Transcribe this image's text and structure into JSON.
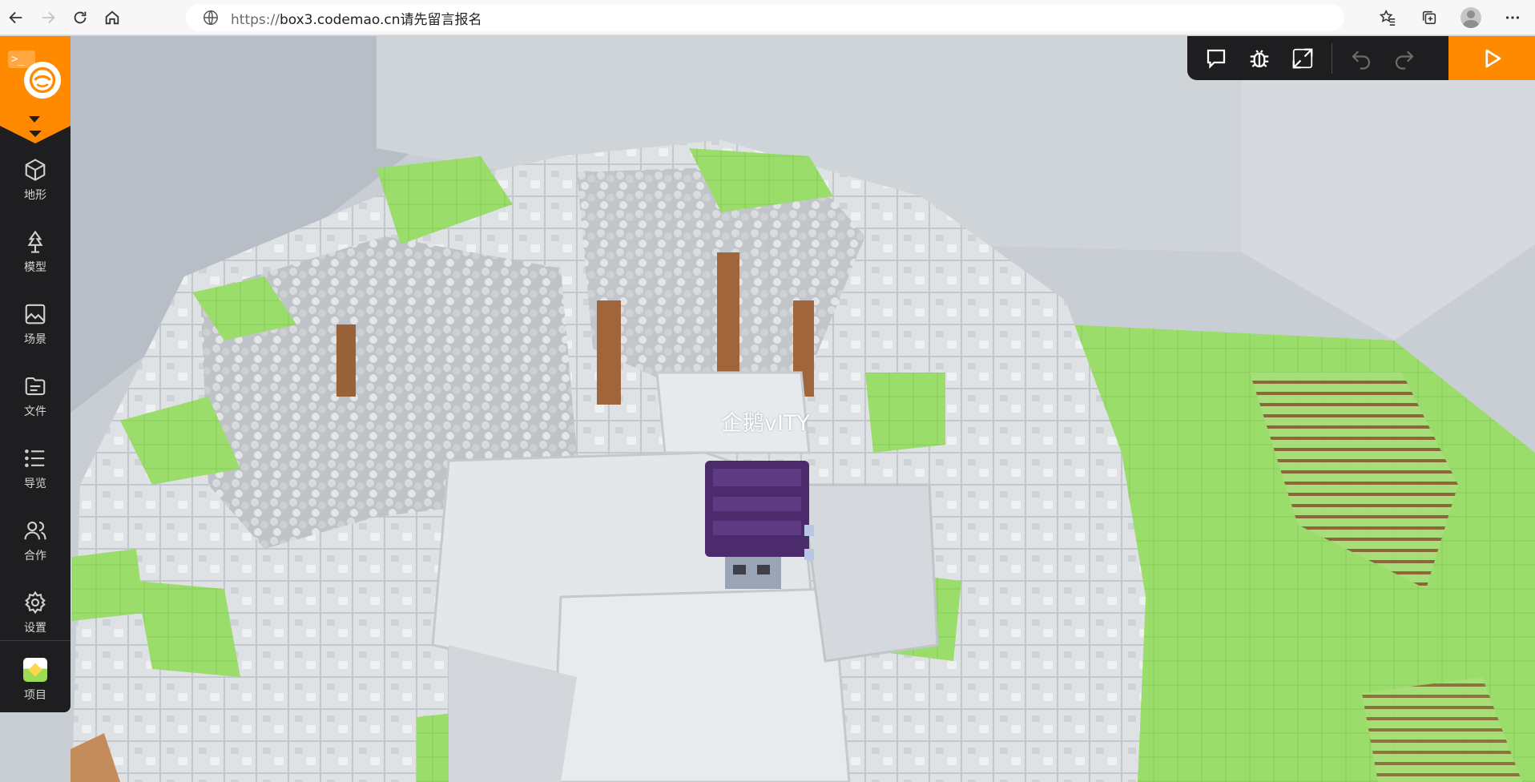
{
  "browser": {
    "url_scheme": "https://",
    "url_rest": "box3.codemao.cn请先留言报名",
    "nav_icons": [
      "back-icon",
      "forward-icon",
      "refresh-icon",
      "home-icon"
    ],
    "right_icons": [
      "favorites-icon",
      "collections-icon",
      "profile-icon",
      "more-icon"
    ]
  },
  "sidebar": {
    "brand_color": "#ff8a00",
    "terminal_glyph": ">_",
    "items": [
      {
        "label": "地形",
        "icon": "cube-icon"
      },
      {
        "label": "模型",
        "icon": "tree-icon"
      },
      {
        "label": "场景",
        "icon": "image-icon"
      },
      {
        "label": "文件",
        "icon": "folder-icon"
      },
      {
        "label": "导览",
        "icon": "list-icon"
      },
      {
        "label": "合作",
        "icon": "users-icon"
      },
      {
        "label": "设置",
        "icon": "gear-icon"
      }
    ],
    "project": {
      "label": "项目",
      "icon": "project-thumbnail"
    }
  },
  "toolbar": {
    "icons": [
      "chat-icon",
      "bug-icon",
      "expand-icon",
      "undo-icon",
      "redo-icon"
    ],
    "play_icon": "play-icon",
    "play_color": "#ff8a00"
  },
  "scene": {
    "player_name": "企鹅vITY",
    "grass_color": "#9bdd6b",
    "stone_color": "#d9dde1"
  }
}
